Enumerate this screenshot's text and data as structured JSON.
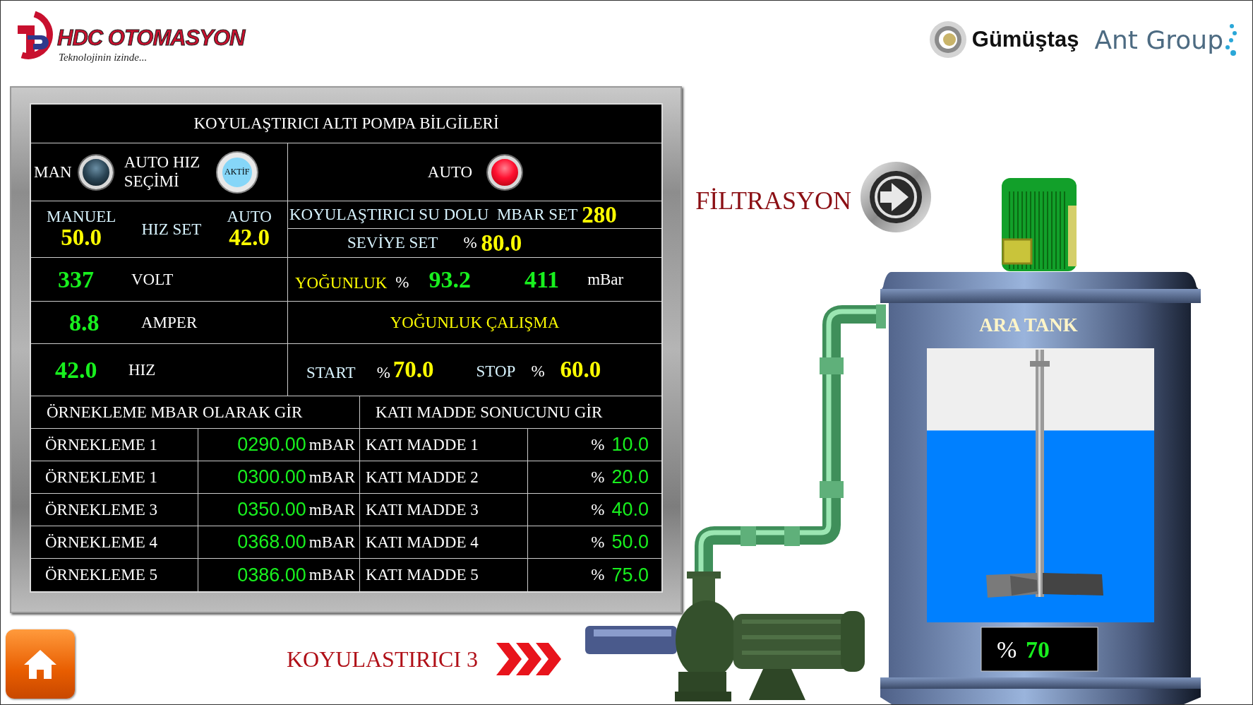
{
  "header": {
    "logo_title": "HDC OTOMASYON",
    "logo_tagline": "Teknolojinin izinde...",
    "partners": [
      "Gümüştaş",
      "Ant Group"
    ]
  },
  "panel": {
    "title": "KOYULAŞTIRICI ALTI POMPA BİLGİLERİ",
    "man_lamp": {
      "label": "MAN",
      "on": false
    },
    "auto_speed_select": {
      "label": "AUTO HIZ SEÇİMİ",
      "button": "AKTİF"
    },
    "auto_lamp": {
      "label": "AUTO",
      "on": true
    },
    "speed_set": {
      "manual_label": "MANUEL",
      "manual_value": "50.0",
      "label": "HIZ SET",
      "auto_label": "AUTO",
      "auto_value": "42.0"
    },
    "water_full": {
      "label": "KOYULAŞTIRICI SU DOLU  MBAR SET",
      "value": "280"
    },
    "level_set": {
      "label": "SEVİYE SET",
      "unit": "%",
      "value": "80.0"
    },
    "readings": [
      {
        "value": "337",
        "label": "VOLT"
      },
      {
        "value": "8.8",
        "label": "AMPER"
      },
      {
        "value": "42.0",
        "label": "HIZ"
      }
    ],
    "density": {
      "label": "YOĞUNLUK",
      "unit": "%",
      "value": "93.2",
      "pressure": "411",
      "pressure_unit": "mBar"
    },
    "density_run": {
      "title": "YOĞUNLUK ÇALIŞMA",
      "start_label": "START",
      "start_unit": "%",
      "start_value": "70.0",
      "stop_label": "STOP",
      "stop_unit": "%",
      "stop_value": "60.0"
    },
    "samples_header": "ÖRNEKLEME MBAR OLARAK GİR",
    "solids_header": "KATI MADDE SONUCUNU GİR",
    "rows": [
      {
        "sample": "ÖRNEKLEME 1",
        "mbar": "0290.00",
        "mbar_unit": "mBAR",
        "solid": "KATI MADDE 1",
        "percent_unit": "%",
        "percent": "10.0"
      },
      {
        "sample": "ÖRNEKLEME 1",
        "mbar": "0300.00",
        "mbar_unit": "mBAR",
        "solid": "KATI MADDE 2",
        "percent_unit": "%",
        "percent": "20.0"
      },
      {
        "sample": "ÖRNEKLEME 3",
        "mbar": "0350.00",
        "mbar_unit": "mBAR",
        "solid": "KATI MADDE 3",
        "percent_unit": "%",
        "percent": "40.0"
      },
      {
        "sample": "ÖRNEKLEME 4",
        "mbar": "0368.00",
        "mbar_unit": "mBAR",
        "solid": "KATI MADDE 4",
        "percent_unit": "%",
        "percent": "50.0"
      },
      {
        "sample": "ÖRNEKLEME 5",
        "mbar": "0386.00",
        "mbar_unit": "mBAR",
        "solid": "KATI MADDE 5",
        "percent_unit": "%",
        "percent": "75.0"
      }
    ]
  },
  "filtration": {
    "label": "FİLTRASYON"
  },
  "pump": {
    "label": "KOYULASTIRICI 3"
  },
  "tank": {
    "title": "ARA TANK",
    "level": 0.7,
    "unit": "%",
    "reading": "70"
  }
}
